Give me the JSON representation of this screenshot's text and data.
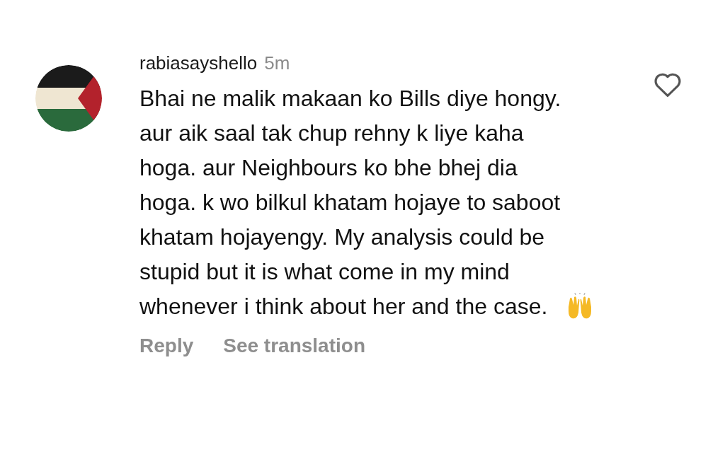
{
  "comment": {
    "username": "rabiasayshello",
    "time": "5m",
    "text": "Bhai ne malik makaan ko Bills diye hongy. aur aik saal tak chup rehny k liye kaha hoga. aur Neighbours ko bhe bhej dia hoga. k wo bilkul khatam hojaye to saboot khatam hojayengy. My analysis could be stupid but it is what come in my mind whenever i think about her and the case.",
    "liked": false,
    "actions": [
      "Reply",
      "See translation"
    ]
  }
}
